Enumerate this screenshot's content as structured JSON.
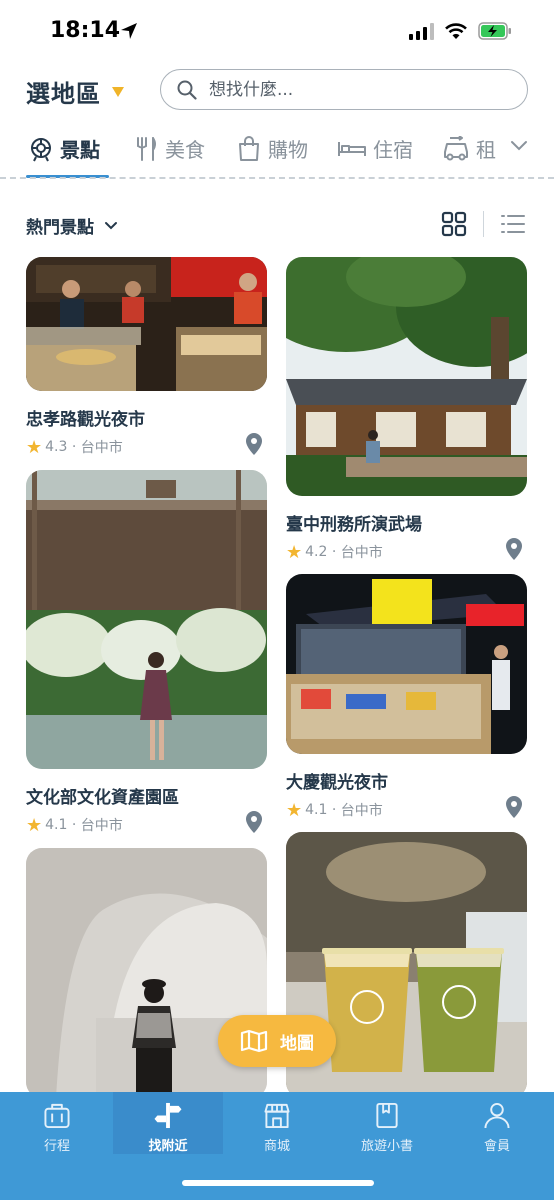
{
  "status_bar": {
    "time": "18:14"
  },
  "header": {
    "region_label": "選地區",
    "search_placeholder": "想找什麼..."
  },
  "tabs": [
    {
      "label": "景點",
      "icon": "attraction-icon",
      "active": true
    },
    {
      "label": "美食",
      "icon": "fork-knife-icon",
      "active": false
    },
    {
      "label": "購物",
      "icon": "shopping-bag-icon",
      "active": false
    },
    {
      "label": "住宿",
      "icon": "bed-icon",
      "active": false
    },
    {
      "label": "租",
      "icon": "car-rental-icon",
      "active": false
    }
  ],
  "toolbar": {
    "sort_label": "熱門景點"
  },
  "cards": [
    {
      "title": "忠孝路觀光夜市",
      "rating": "4.3",
      "location": "台中市"
    },
    {
      "title": "臺中刑務所演武場",
      "rating": "4.2",
      "location": "台中市"
    },
    {
      "title": "文化部文化資產園區",
      "rating": "4.1",
      "location": "台中市"
    },
    {
      "title": "大慶觀光夜市",
      "rating": "4.1",
      "location": "台中市"
    },
    {
      "title": "",
      "rating": "",
      "location": ""
    },
    {
      "title": "",
      "rating": "",
      "location": ""
    }
  ],
  "map_button": {
    "label": "地圖"
  },
  "bottom_nav": [
    {
      "label": "行程",
      "icon": "suitcase-icon",
      "active": false
    },
    {
      "label": "找附近",
      "icon": "signpost-icon",
      "active": true
    },
    {
      "label": "商城",
      "icon": "store-icon",
      "active": false
    },
    {
      "label": "旅遊小書",
      "icon": "book-icon",
      "active": false
    },
    {
      "label": "會員",
      "icon": "user-icon",
      "active": false
    }
  ],
  "colors": {
    "accent": "#3a8fd0",
    "nav_bg": "#3f99d6",
    "star": "#f2b530",
    "map_button": "#f6b940",
    "text": "#25384a"
  }
}
